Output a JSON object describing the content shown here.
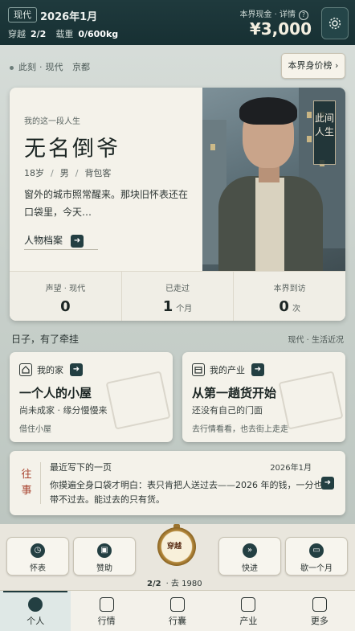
{
  "topbar": {
    "era": "现代",
    "date": "2026年1月",
    "travel_label": "穿越",
    "travel_value": "2/2",
    "load_label": "载重",
    "load_value": "0/600kg",
    "cash_label": "本界现金 · 详情",
    "cash_value": "¥3,000"
  },
  "location": {
    "prefix": "此刻",
    "era": "现代",
    "city": "京都"
  },
  "rank_button": "本界身价榜 ›",
  "character": {
    "subtitle": "我的这一段人生",
    "name": "无名倒爷",
    "age": "18岁",
    "gender": "男",
    "job": "背包客",
    "description": "窗外的城市照常醒来。那块旧怀表还在口袋里，今天…",
    "profile_button": "人物档案",
    "vertical_label": "此间人生",
    "stats": [
      {
        "label": "声望 · 现代",
        "value": "0",
        "unit": ""
      },
      {
        "label": "已走过",
        "value": "1",
        "unit": "个月"
      },
      {
        "label": "本界到访",
        "value": "0",
        "unit": "次"
      }
    ]
  },
  "section": {
    "title": "日子，有了牵挂",
    "right": "现代 · 生活近况"
  },
  "home_card": {
    "header": "我的家",
    "title": "一个人的小屋",
    "text": "尚未成家 · 缘分慢慢来",
    "footer": "借住小屋"
  },
  "business_card": {
    "header": "我的产业",
    "title": "从第一趟货开始",
    "text": "还没有自己的门面",
    "footer": "去行情看看，也去街上走走"
  },
  "journal": {
    "side_label": "往事",
    "title": "最近写下的一页",
    "date": "2026年1月",
    "body": "你摸遍全身口袋才明白：表只肯把人送过去——2026 年的钱，一分也带不过去。能过去的只有货。"
  },
  "controls": {
    "watch_label": "怀表",
    "sponsor_label": "赞助",
    "watch_face": "穿越",
    "turn_count": "2/2",
    "turn_dest": "· 去 1980",
    "fast_label": "快进",
    "month_label": "歇一个月"
  },
  "tabs": [
    "个人",
    "行情",
    "行囊",
    "产业",
    "更多"
  ]
}
